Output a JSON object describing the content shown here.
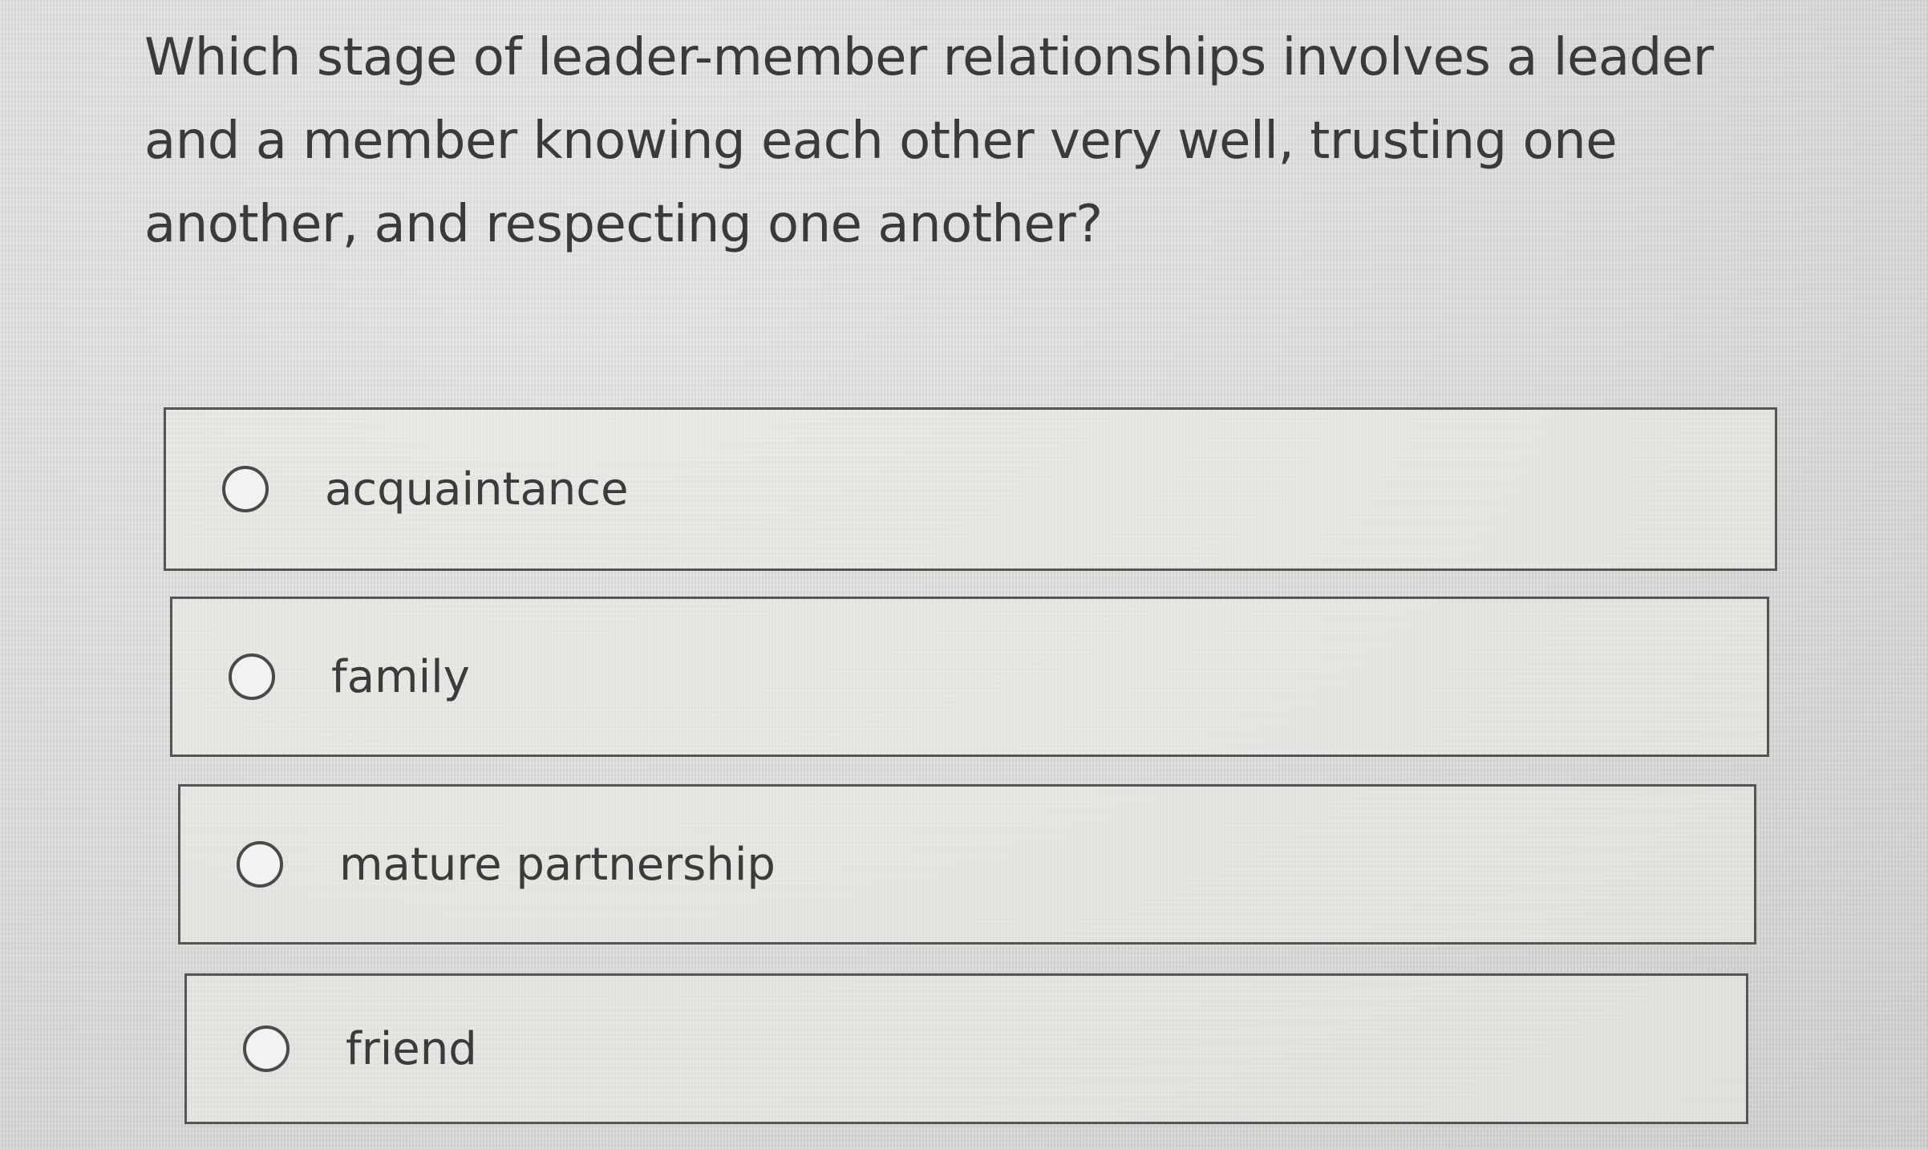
{
  "question": {
    "text": "Which stage of leader-member relationships involves a leader and a member knowing each other very well, trusting one another, and respecting one another?"
  },
  "options": [
    {
      "label": "acquaintance",
      "selected": false
    },
    {
      "label": "family",
      "selected": false
    },
    {
      "label": "mature partnership",
      "selected": false
    },
    {
      "label": "friend",
      "selected": false
    }
  ]
}
